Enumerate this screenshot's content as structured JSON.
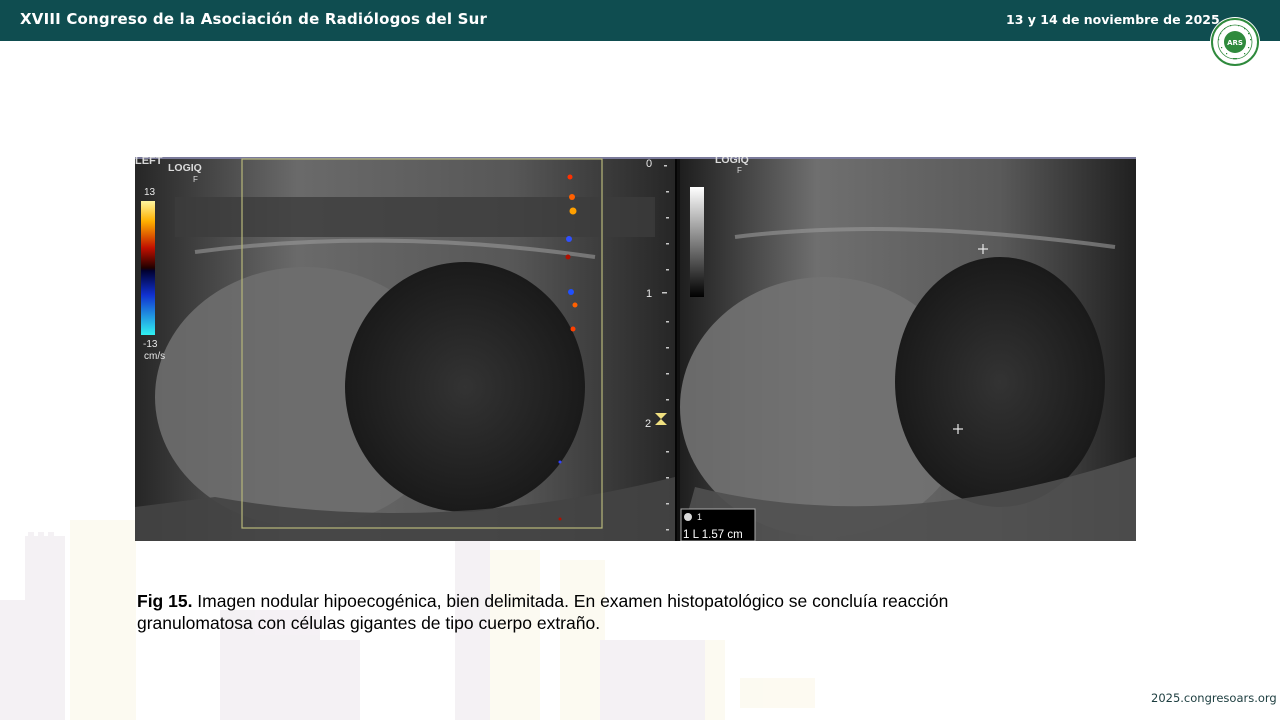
{
  "header": {
    "title": "XVIII Congreso de la Asociación de Radiólogos del Sur",
    "date": "13 y 14 de noviembre de 2025",
    "logo_text": "ARS",
    "logo_ring_text": "ASOCIACIÓN RADIÓLOGOS SUR",
    "background_color": "#0f4d50"
  },
  "figure": {
    "left_panel": {
      "label_top": "LOGIQ",
      "label_sub": "F",
      "corner_text": "LEFT",
      "scale_max": "13",
      "scale_min": "-13",
      "scale_unit": "cm/s",
      "depth_marks": [
        "0",
        "1",
        "2"
      ]
    },
    "right_panel": {
      "label_top": "LOGIQ",
      "label_sub": "F",
      "measurement_marker": "1",
      "measurement": "1 L 1.57 cm"
    }
  },
  "caption": {
    "label": "Fig 15.",
    "text": " Imagen nodular hipoecogénica, bien delimitada. En examen histopatológico se concluía reacción granulomatosa con células gigantes de tipo cuerpo extraño."
  },
  "footer": {
    "url": "2025.congresoars.org"
  }
}
